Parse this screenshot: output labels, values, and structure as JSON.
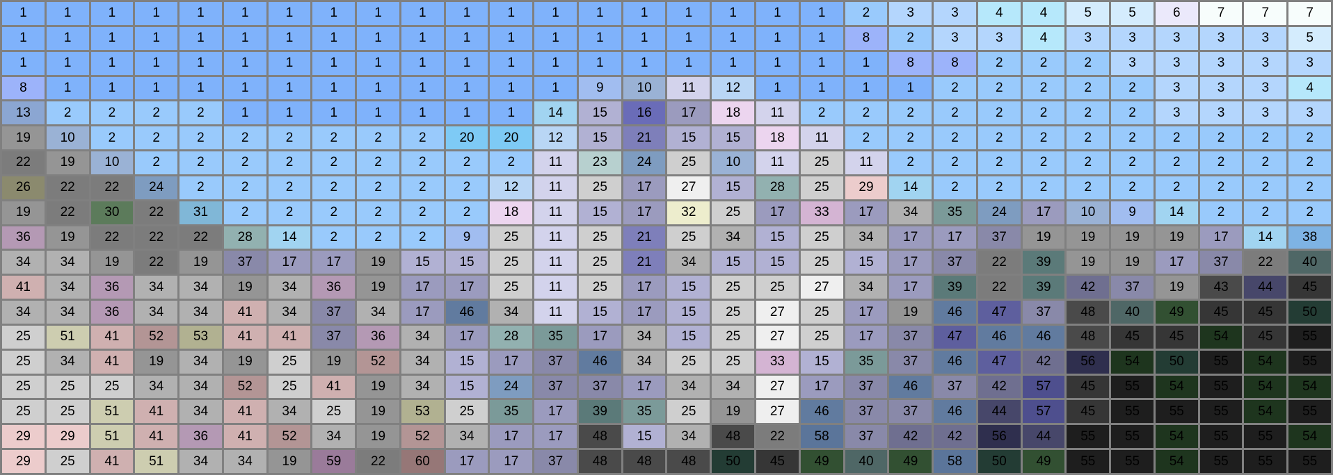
{
  "grid": {
    "rows": [
      [
        1,
        1,
        1,
        1,
        1,
        1,
        1,
        1,
        1,
        1,
        1,
        1,
        1,
        1,
        1,
        1,
        1,
        1,
        1,
        2,
        3,
        3,
        4,
        4,
        5,
        5,
        6,
        7,
        7,
        7
      ],
      [
        1,
        1,
        1,
        1,
        1,
        1,
        1,
        1,
        1,
        1,
        1,
        1,
        1,
        1,
        1,
        1,
        1,
        1,
        1,
        8,
        2,
        3,
        3,
        4,
        3,
        3,
        3,
        3,
        3,
        5
      ],
      [
        1,
        1,
        1,
        1,
        1,
        1,
        1,
        1,
        1,
        1,
        1,
        1,
        1,
        1,
        1,
        1,
        1,
        1,
        1,
        1,
        8,
        8,
        2,
        2,
        2,
        3,
        3,
        3,
        3,
        3
      ],
      [
        8,
        1,
        1,
        1,
        1,
        1,
        1,
        1,
        1,
        1,
        1,
        1,
        1,
        9,
        10,
        11,
        12,
        1,
        1,
        1,
        1,
        2,
        2,
        2,
        2,
        2,
        3,
        3,
        3,
        4
      ],
      [
        13,
        2,
        2,
        2,
        2,
        1,
        1,
        1,
        1,
        1,
        1,
        1,
        14,
        15,
        16,
        17,
        18,
        11,
        2,
        2,
        2,
        2,
        2,
        2,
        2,
        2,
        3,
        3,
        3,
        3
      ],
      [
        19,
        10,
        2,
        2,
        2,
        2,
        2,
        2,
        2,
        2,
        20,
        20,
        12,
        15,
        21,
        15,
        15,
        18,
        11,
        2,
        2,
        2,
        2,
        2,
        2,
        2,
        2,
        2,
        2,
        2
      ],
      [
        22,
        19,
        10,
        2,
        2,
        2,
        2,
        2,
        2,
        2,
        2,
        2,
        11,
        23,
        24,
        25,
        10,
        11,
        25,
        11,
        2,
        2,
        2,
        2,
        2,
        2,
        2,
        2,
        2,
        2
      ],
      [
        26,
        22,
        22,
        24,
        2,
        2,
        2,
        2,
        2,
        2,
        2,
        12,
        11,
        25,
        17,
        27,
        15,
        28,
        25,
        29,
        14,
        2,
        2,
        2,
        2,
        2,
        2,
        2,
        2,
        2
      ],
      [
        19,
        22,
        30,
        22,
        31,
        2,
        2,
        2,
        2,
        2,
        2,
        18,
        11,
        15,
        17,
        32,
        25,
        17,
        33,
        17,
        34,
        35,
        24,
        17,
        10,
        9,
        14,
        2,
        2,
        2
      ],
      [
        36,
        19,
        22,
        22,
        22,
        28,
        14,
        2,
        2,
        2,
        9,
        25,
        11,
        25,
        21,
        25,
        34,
        15,
        25,
        34,
        17,
        17,
        37,
        19,
        19,
        19,
        19,
        17,
        14,
        38
      ],
      [
        34,
        34,
        19,
        22,
        19,
        37,
        17,
        17,
        19,
        15,
        15,
        25,
        11,
        25,
        21,
        34,
        15,
        15,
        25,
        15,
        17,
        37,
        22,
        39,
        19,
        19,
        17,
        37,
        22,
        40
      ],
      [
        41,
        34,
        36,
        34,
        34,
        19,
        34,
        36,
        19,
        17,
        17,
        25,
        11,
        25,
        17,
        15,
        25,
        25,
        27,
        34,
        17,
        39,
        22,
        39,
        42,
        37,
        19,
        43,
        44,
        45
      ],
      [
        34,
        34,
        36,
        34,
        34,
        41,
        34,
        37,
        34,
        17,
        46,
        34,
        11,
        15,
        17,
        15,
        25,
        27,
        25,
        17,
        19,
        46,
        47,
        37,
        48,
        40,
        49,
        45,
        45,
        50
      ],
      [
        25,
        51,
        41,
        52,
        53,
        41,
        41,
        37,
        36,
        34,
        17,
        28,
        35,
        17,
        34,
        15,
        25,
        27,
        25,
        17,
        37,
        47,
        46,
        46,
        48,
        45,
        45,
        54,
        45,
        55
      ],
      [
        25,
        34,
        41,
        19,
        34,
        19,
        25,
        19,
        52,
        34,
        15,
        17,
        37,
        46,
        34,
        25,
        25,
        33,
        15,
        35,
        37,
        46,
        47,
        42,
        56,
        54,
        50,
        55,
        54,
        55
      ],
      [
        25,
        25,
        25,
        34,
        34,
        52,
        25,
        41,
        19,
        34,
        15,
        24,
        37,
        37,
        17,
        34,
        34,
        27,
        17,
        37,
        46,
        37,
        42,
        57,
        45,
        55,
        54,
        55,
        54,
        54
      ],
      [
        25,
        25,
        51,
        41,
        34,
        41,
        34,
        25,
        19,
        53,
        25,
        35,
        17,
        39,
        35,
        25,
        19,
        27,
        46,
        37,
        37,
        46,
        44,
        57,
        45,
        55,
        55,
        55,
        54,
        55
      ],
      [
        29,
        29,
        51,
        41,
        36,
        41,
        52,
        34,
        19,
        52,
        34,
        17,
        17,
        48,
        15,
        34,
        48,
        22,
        58,
        37,
        42,
        42,
        56,
        44,
        55,
        55,
        54,
        55,
        55,
        54
      ],
      [
        29,
        25,
        41,
        51,
        34,
        34,
        19,
        59,
        22,
        60,
        17,
        17,
        37,
        48,
        48,
        48,
        50,
        45,
        49,
        40,
        49,
        58,
        50,
        49,
        55,
        55,
        54,
        55,
        55,
        55
      ]
    ],
    "colors": {
      "1": "#7fb2fb",
      "2": "#99cafc",
      "3": "#b4d6fd",
      "4": "#b6e8fb",
      "5": "#d4ecfd",
      "6": "#ebe9fb",
      "7": "#f7fdfc",
      "8": "#9cb3fa",
      "9": "#a1bdf0",
      "10": "#9ab2d5",
      "11": "#d3d3ec",
      "12": "#b9d6f5",
      "13": "#8ba6d2",
      "14": "#a1d4f1",
      "15": "#b1b1d3",
      "16": "#6a6cb8",
      "17": "#9b9bbe",
      "18": "#ecd5ef",
      "19": "#959595",
      "20": "#7ecaf5",
      "21": "#7e7fba",
      "22": "#7c7c7c",
      "23": "#b7d0cf",
      "24": "#7e9cc0",
      "25": "#cfcfcf",
      "26": "#8b8a6e",
      "27": "#efefef",
      "28": "#92b1b0",
      "29": "#eccccc",
      "30": "#5c7b5b",
      "31": "#80b7d7",
      "32": "#ededcd",
      "33": "#d4b4d3",
      "34": "#b1b1b1",
      "35": "#7b9a99",
      "36": "#b499b4",
      "37": "#8989a9",
      "38": "#7eb3e4",
      "39": "#5b7a79",
      "40": "#4f6766",
      "41": "#cfb0b0",
      "42": "#6f6f90",
      "43": "#4a4a4a",
      "44": "#47476a",
      "45": "#363636",
      "46": "#617b9f",
      "47": "#5e5f9e",
      "48": "#4a4a4a",
      "49": "#325032",
      "50": "#233c34",
      "51": "#cdcdb0",
      "52": "#b39595",
      "53": "#b1b191",
      "54": "#1e351e",
      "55": "#1e1e1e",
      "56": "#2f2f4e",
      "57": "#4e4f8e",
      "58": "#5b759a",
      "59": "#9a7b9a",
      "60": "#967777"
    }
  }
}
